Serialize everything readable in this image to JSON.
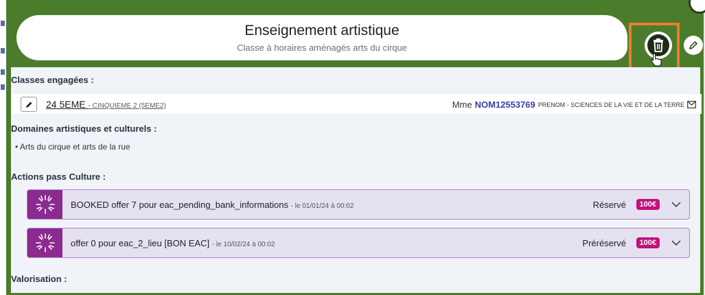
{
  "header": {
    "title": "Enseignement artistique",
    "subtitle": "Classe à horaires aménagés arts du cirque"
  },
  "sections": {
    "classes_label": "Classes engagées :",
    "domaines_label": "Domaines artistiques et culturels :",
    "actions_label": "Actions pass Culture :",
    "valorisation_label": "Valorisation :"
  },
  "class_row": {
    "name": "24 5EME",
    "sub": "- CINQUIEME 2 (5EME2)",
    "teacher_prefix": "Mme",
    "teacher_name": "NOM12553769",
    "teacher_rest": "PRENOM - SCIENCES DE LA VIE ET DE LA TERRE"
  },
  "domaines": [
    "Arts du cirque et arts de la rue"
  ],
  "actions": [
    {
      "title": "BOOKED offer 7 pour eac_pending_bank_informations",
      "date": "- le 01/01/24 à 00:02",
      "status": "Réservé",
      "price": "100€"
    },
    {
      "title": "offer 0 pour eac_2_lieu [BON EAC]",
      "date": "- le 10/02/24 à 00:02",
      "status": "Préréservé",
      "price": "100€"
    }
  ],
  "colors": {
    "frame": "#4b7c2b",
    "highlight": "#ec7c2a",
    "action_icon": "#8b2a8f",
    "price_badge": "#c3117a"
  },
  "icons": [
    "trash-icon",
    "pencil-icon",
    "mail-icon",
    "chevron-down-icon",
    "pass-culture-burst-icon"
  ]
}
